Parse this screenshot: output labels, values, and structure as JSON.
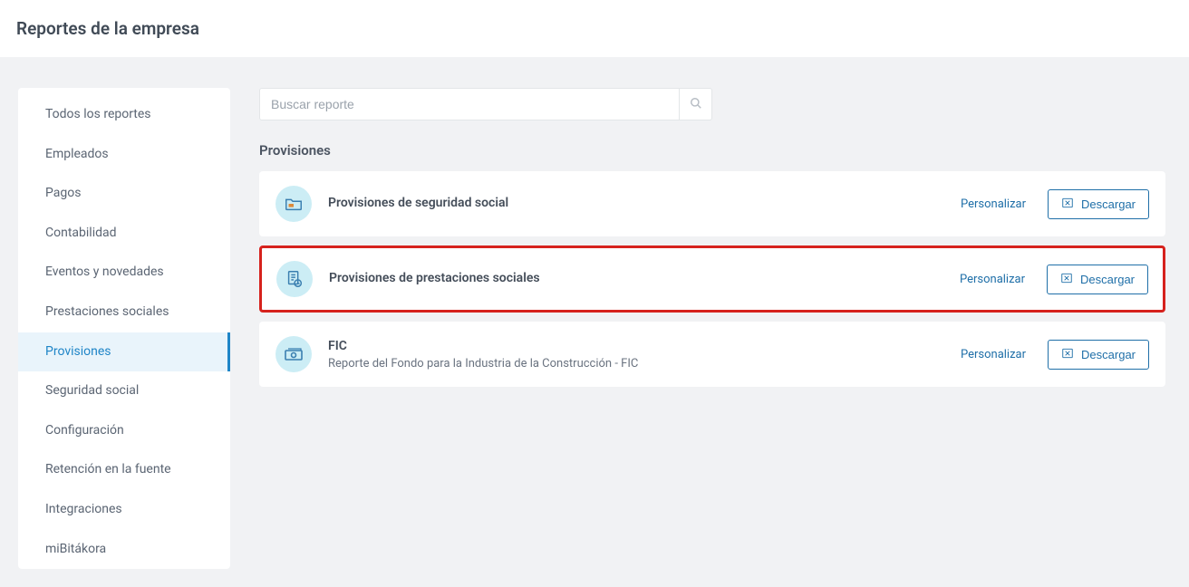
{
  "header": {
    "title": "Reportes de la empresa"
  },
  "sidebar": {
    "items": [
      {
        "label": "Todos los reportes"
      },
      {
        "label": "Empleados"
      },
      {
        "label": "Pagos"
      },
      {
        "label": "Contabilidad"
      },
      {
        "label": "Eventos y novedades"
      },
      {
        "label": "Prestaciones sociales"
      },
      {
        "label": "Provisiones"
      },
      {
        "label": "Seguridad social"
      },
      {
        "label": "Configuración"
      },
      {
        "label": "Retención en la fuente"
      },
      {
        "label": "Integraciones"
      },
      {
        "label": "miBitákora"
      }
    ],
    "active_index": 6
  },
  "search": {
    "placeholder": "Buscar reporte",
    "value": ""
  },
  "section": {
    "title": "Provisiones"
  },
  "actions": {
    "personalize": "Personalizar",
    "download": "Descargar"
  },
  "cards": [
    {
      "title": "Provisiones de seguridad social",
      "desc": ""
    },
    {
      "title": "Provisiones de prestaciones sociales",
      "desc": ""
    },
    {
      "title": "FIC",
      "desc": "Reporte del Fondo para la Industria de la Construcción - FIC"
    }
  ],
  "highlight_index": 1
}
